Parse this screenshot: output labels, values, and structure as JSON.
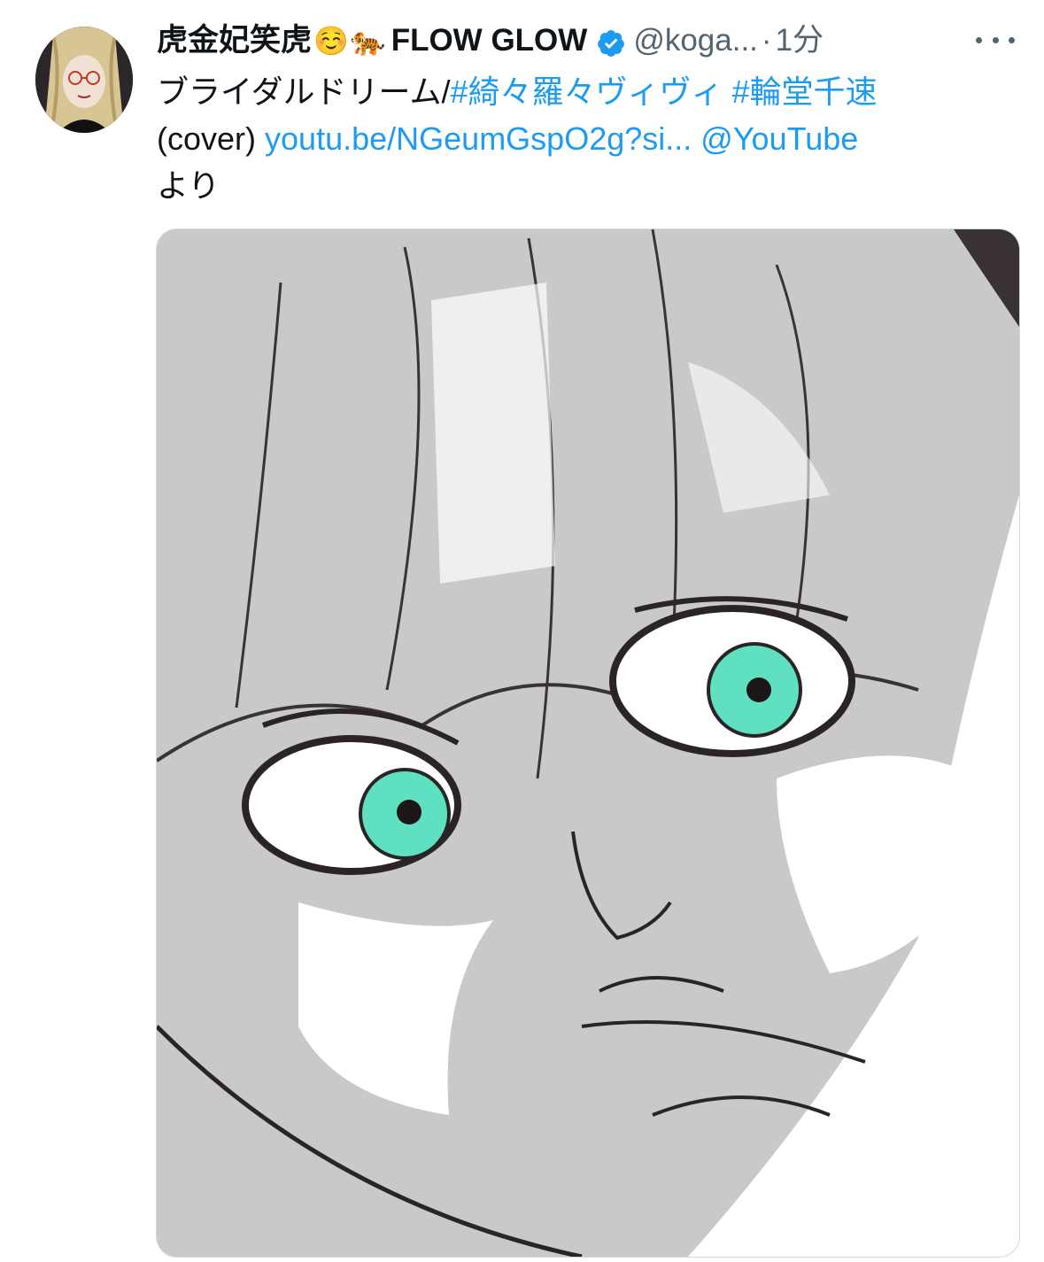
{
  "tweet": {
    "author": {
      "display_name": "虎金妃笑虎",
      "emoji_1": "☺️",
      "emoji_2": "🐅",
      "name_suffix": "FLOW GLOW",
      "handle": "@koga...",
      "verified": true
    },
    "separator": "·",
    "time": "1分",
    "text": {
      "line1_plain": "ブライダルドリーム/",
      "hashtag1": "#綺々羅々ヴィヴィ",
      "hashtag2": "#輪堂千速",
      "paren": "(cover)",
      "link": "youtu.be/NGeumGspO2g?si...",
      "mention": "@YouTube",
      "suffix": "より"
    },
    "media": {
      "type": "image",
      "description_icon": "illustration-image"
    }
  },
  "colors": {
    "link": "#1d9bf0",
    "secondary_text": "#536471",
    "primary_text": "#0f1419",
    "verified_badge": "#1d9bf0"
  }
}
